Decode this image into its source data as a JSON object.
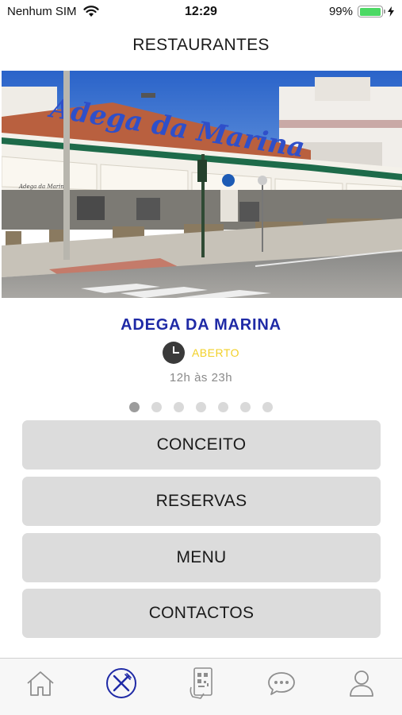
{
  "status_bar": {
    "carrier": "Nenhum SIM",
    "time": "12:29",
    "battery_percent": "99%",
    "battery_level": 0.99,
    "battery_color": "#4cd964"
  },
  "nav": {
    "title": "RESTAURANTES"
  },
  "restaurant": {
    "name": "ADEGA DA MARINA",
    "status": "ABERTO",
    "hours": "12h às 23h",
    "name_color": "#1f2aa6",
    "status_color": "#f2d027",
    "sign_text": "Adega da Marina",
    "awning_text": "Adega da Marina"
  },
  "pager": {
    "total": 7,
    "active_index": 0
  },
  "menu": {
    "concept_label": "CONCEITO",
    "reservations_label": "RESERVAS",
    "menu_label": "MENU",
    "contacts_label": "CONTACTOS"
  },
  "tab_bar": {
    "items": [
      {
        "icon": "home-icon",
        "active": false
      },
      {
        "icon": "fork-knife-icon",
        "active": true
      },
      {
        "icon": "qr-phone-icon",
        "active": false
      },
      {
        "icon": "chat-bubble-icon",
        "active": false
      },
      {
        "icon": "user-icon",
        "active": false
      }
    ],
    "active_color": "#1f2aa6",
    "inactive_color": "#8e8e8e"
  }
}
